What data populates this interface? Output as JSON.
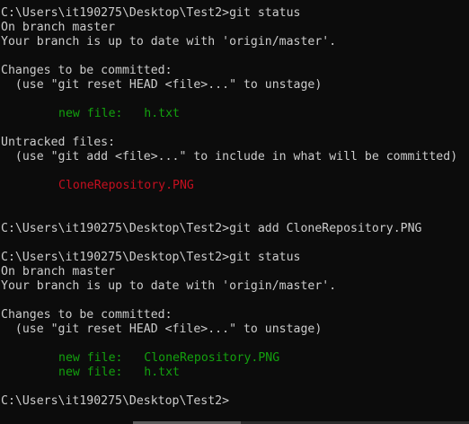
{
  "terminal": {
    "lines": [
      {
        "kind": "command",
        "prompt": "C:\\Users\\it190275\\Desktop\\Test2>",
        "command": "git status"
      },
      {
        "kind": "text",
        "text": "On branch master"
      },
      {
        "kind": "text",
        "text": "Your branch is up to date with 'origin/master'."
      },
      {
        "kind": "blank",
        "text": ""
      },
      {
        "kind": "text",
        "text": "Changes to be committed:"
      },
      {
        "kind": "text",
        "text": "  (use \"git reset HEAD <file>...\" to unstage)"
      },
      {
        "kind": "blank",
        "text": ""
      },
      {
        "kind": "staged",
        "label": "new file:",
        "file": "h.txt"
      },
      {
        "kind": "blank",
        "text": ""
      },
      {
        "kind": "text",
        "text": "Untracked files:"
      },
      {
        "kind": "text",
        "text": "  (use \"git add <file>...\" to include in what will be committed)"
      },
      {
        "kind": "blank",
        "text": ""
      },
      {
        "kind": "untracked",
        "file": "CloneRepository.PNG"
      },
      {
        "kind": "blank",
        "text": ""
      },
      {
        "kind": "blank",
        "text": ""
      },
      {
        "kind": "command",
        "prompt": "C:\\Users\\it190275\\Desktop\\Test2>",
        "command": "git add CloneRepository.PNG"
      },
      {
        "kind": "blank",
        "text": ""
      },
      {
        "kind": "command",
        "prompt": "C:\\Users\\it190275\\Desktop\\Test2>",
        "command": "git status"
      },
      {
        "kind": "text",
        "text": "On branch master"
      },
      {
        "kind": "text",
        "text": "Your branch is up to date with 'origin/master'."
      },
      {
        "kind": "blank",
        "text": ""
      },
      {
        "kind": "text",
        "text": "Changes to be committed:"
      },
      {
        "kind": "text",
        "text": "  (use \"git reset HEAD <file>...\" to unstage)"
      },
      {
        "kind": "blank",
        "text": ""
      },
      {
        "kind": "staged",
        "label": "new file:",
        "file": "CloneRepository.PNG"
      },
      {
        "kind": "staged",
        "label": "new file:",
        "file": "h.txt"
      },
      {
        "kind": "blank",
        "text": ""
      },
      {
        "kind": "prompt",
        "prompt": "C:\\Users\\it190275\\Desktop\\Test2>"
      }
    ]
  },
  "colors": {
    "background": "#0c0c0c",
    "foreground": "#cccccc",
    "staged": "#13a10e",
    "untracked": "#c50f1f"
  }
}
